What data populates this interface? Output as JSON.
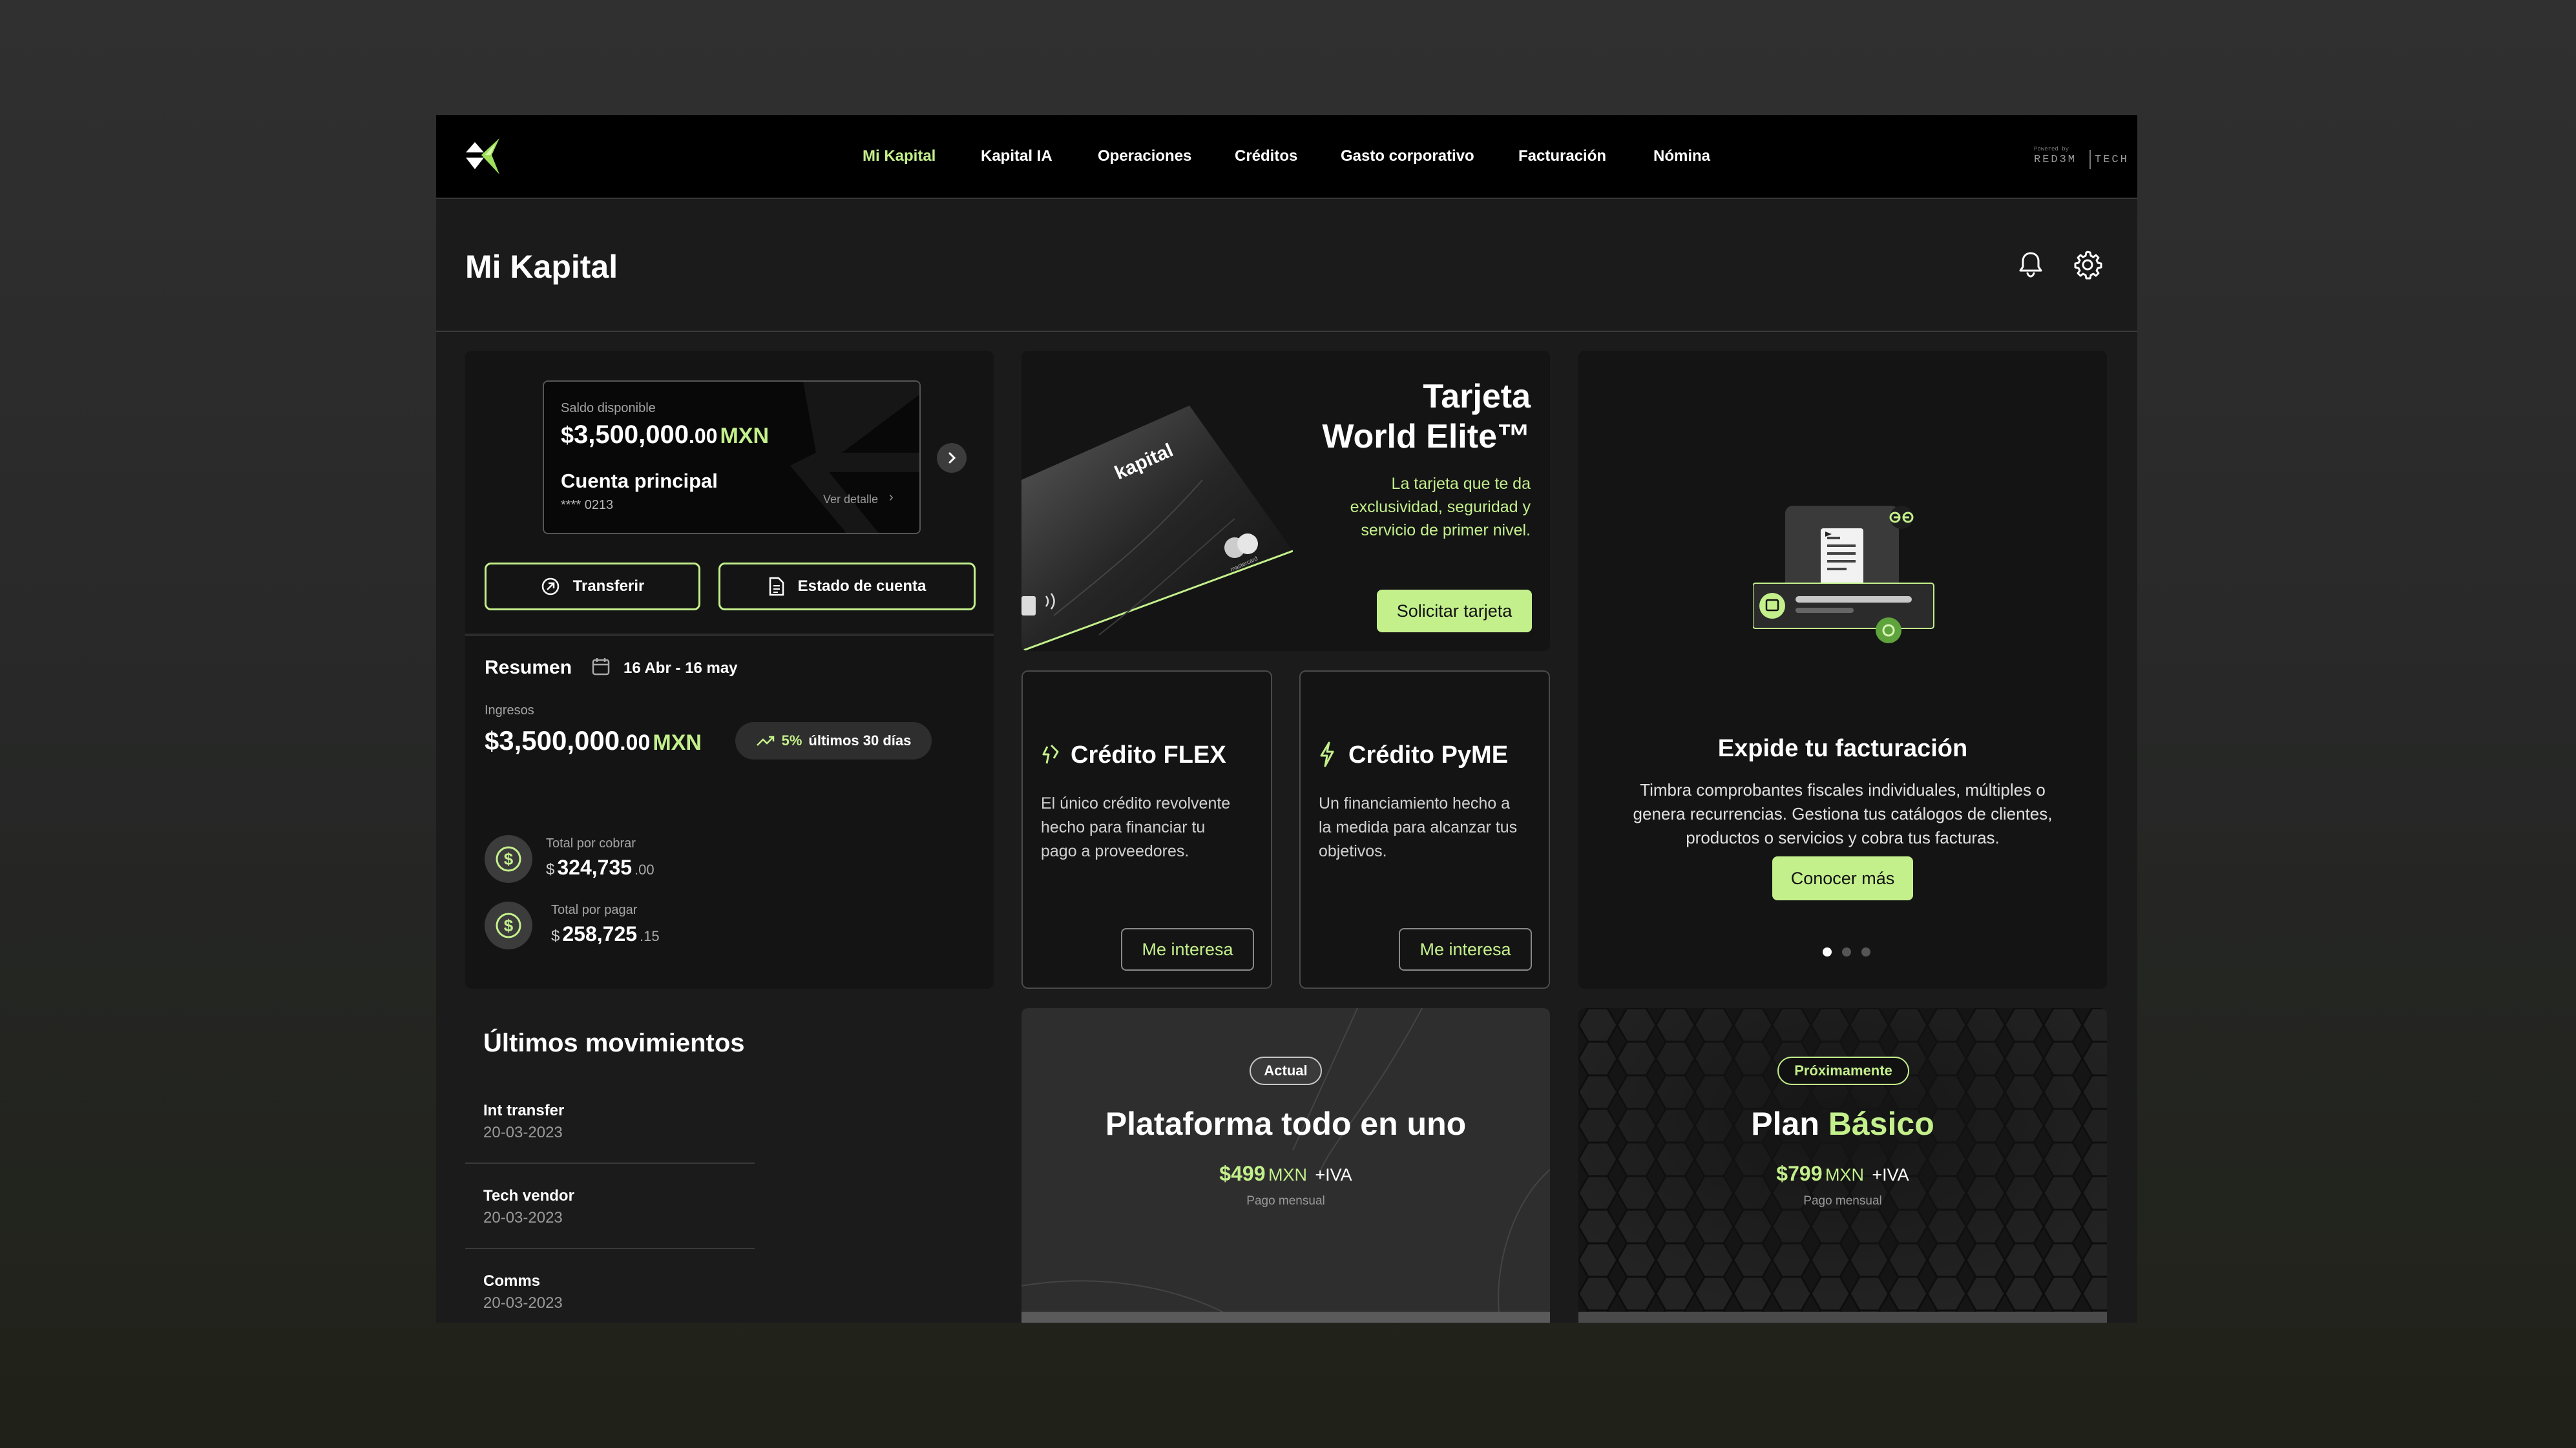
{
  "header": {
    "nav": [
      {
        "label": "Mi Kapital",
        "active": true
      },
      {
        "label": "Kapital IA",
        "active": false
      },
      {
        "label": "Operaciones",
        "active": false
      },
      {
        "label": "Créditos",
        "active": false
      },
      {
        "label": "Gasto corporativo",
        "active": false
      },
      {
        "label": "Facturación",
        "active": false
      },
      {
        "label": "Nómina",
        "active": false
      }
    ],
    "brand": {
      "powered": "Powered by",
      "left": "RED3M",
      "right": "TECH"
    }
  },
  "page": {
    "title": "Mi Kapital"
  },
  "account": {
    "balance_label": "Saldo disponible",
    "currency_symbol": "$",
    "balance_int": "3,500,000",
    "balance_dec": ".00",
    "currency": "MXN",
    "name": "Cuenta principal",
    "number": "**** 0213",
    "detail_link": "Ver detalle",
    "transfer_label": "Transferir",
    "statement_label": "Estado de cuenta"
  },
  "summary": {
    "title": "Resumen",
    "date_range": "16 Abr - 16 may",
    "income_label": "Ingresos",
    "income_int": "3,500,000",
    "income_dec": ".00",
    "currency": "MXN",
    "growth_value": "5%",
    "growth_label": "últimos 30 días",
    "receivable_label": "Total por cobrar",
    "receivable_int": "324,735",
    "receivable_dec": ".00",
    "payable_label": "Total por pagar",
    "payable_int": "258,725",
    "payable_dec": ".15"
  },
  "movements": {
    "title": "Últimos movimientos",
    "items": [
      {
        "name": "Int transfer",
        "date": "20-03-2023"
      },
      {
        "name": "Tech vendor",
        "date": "20-03-2023"
      },
      {
        "name": "Comms",
        "date": "20-03-2023"
      }
    ]
  },
  "promo_card": {
    "title_line1": "Tarjeta",
    "title_line2": "World Elite™",
    "desc_line1": "La tarjeta que te da",
    "desc_line2": "exclusividad, seguridad y",
    "desc_line3": "servicio de primer nivel.",
    "cta": "Solicitar tarjeta",
    "card_brand": "kapital",
    "card_network": "mastercard"
  },
  "credit_flex": {
    "title": "Crédito FLEX",
    "desc_line1": "El único crédito revolvente",
    "desc_line2": "hecho para financiar tu",
    "desc_line3": "pago a proveedores.",
    "cta": "Me interesa"
  },
  "credit_pyme": {
    "title": "Crédito PyME",
    "desc_line1": "Un financiamiento hecho a",
    "desc_line2": "la medida para alcanzar tus",
    "desc_line3": "objetivos.",
    "cta": "Me interesa"
  },
  "invoice": {
    "title": "Expide tu facturación",
    "desc_line1": "Timbra comprobantes fiscales individuales, múltiples o",
    "desc_line2": "genera recurrencias. Gestiona tus catálogos de clientes,",
    "desc_line3": "productos o servicios y cobra tus facturas.",
    "cta": "Conocer más",
    "carousel_active": 1,
    "carousel_total": 3
  },
  "plan_current": {
    "badge": "Actual",
    "title": "Plataforma todo en uno",
    "price": "$499",
    "currency": "MXN",
    "tax": "+IVA",
    "period": "Pago mensual"
  },
  "plan_next": {
    "badge": "Próximamente",
    "title_prefix": "Plan",
    "title_highlight": "Básico",
    "price": "$799",
    "currency": "MXN",
    "tax": "+IVA",
    "period": "Pago mensual"
  },
  "colors": {
    "accent": "#c4f08c",
    "background": "#1b1b1b",
    "panel": "#141414"
  }
}
